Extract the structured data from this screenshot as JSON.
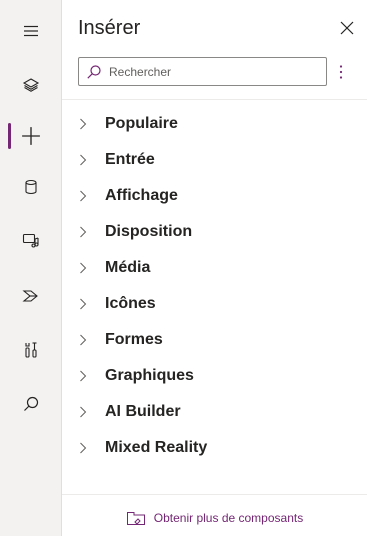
{
  "rail": {
    "items": [
      {
        "icon": "hamburger-icon",
        "active": false
      },
      {
        "icon": "layers-icon",
        "active": false
      },
      {
        "icon": "plus-icon",
        "active": true
      },
      {
        "icon": "database-icon",
        "active": false
      },
      {
        "icon": "media-icon",
        "active": false
      },
      {
        "icon": "power-automate-icon",
        "active": false
      },
      {
        "icon": "tools-icon",
        "active": false
      },
      {
        "icon": "search-icon",
        "active": false
      }
    ]
  },
  "panel": {
    "title": "Insérer",
    "search_placeholder": "Rechercher",
    "categories": [
      "Populaire",
      "Entrée",
      "Affichage",
      "Disposition",
      "Média",
      "Icônes",
      "Formes",
      "Graphiques",
      "AI Builder",
      "Mixed Reality"
    ],
    "footer_label": "Obtenir plus de composants"
  },
  "colors": {
    "accent": "#742774",
    "rail_bg": "#f3f2f1",
    "text": "#252423"
  }
}
